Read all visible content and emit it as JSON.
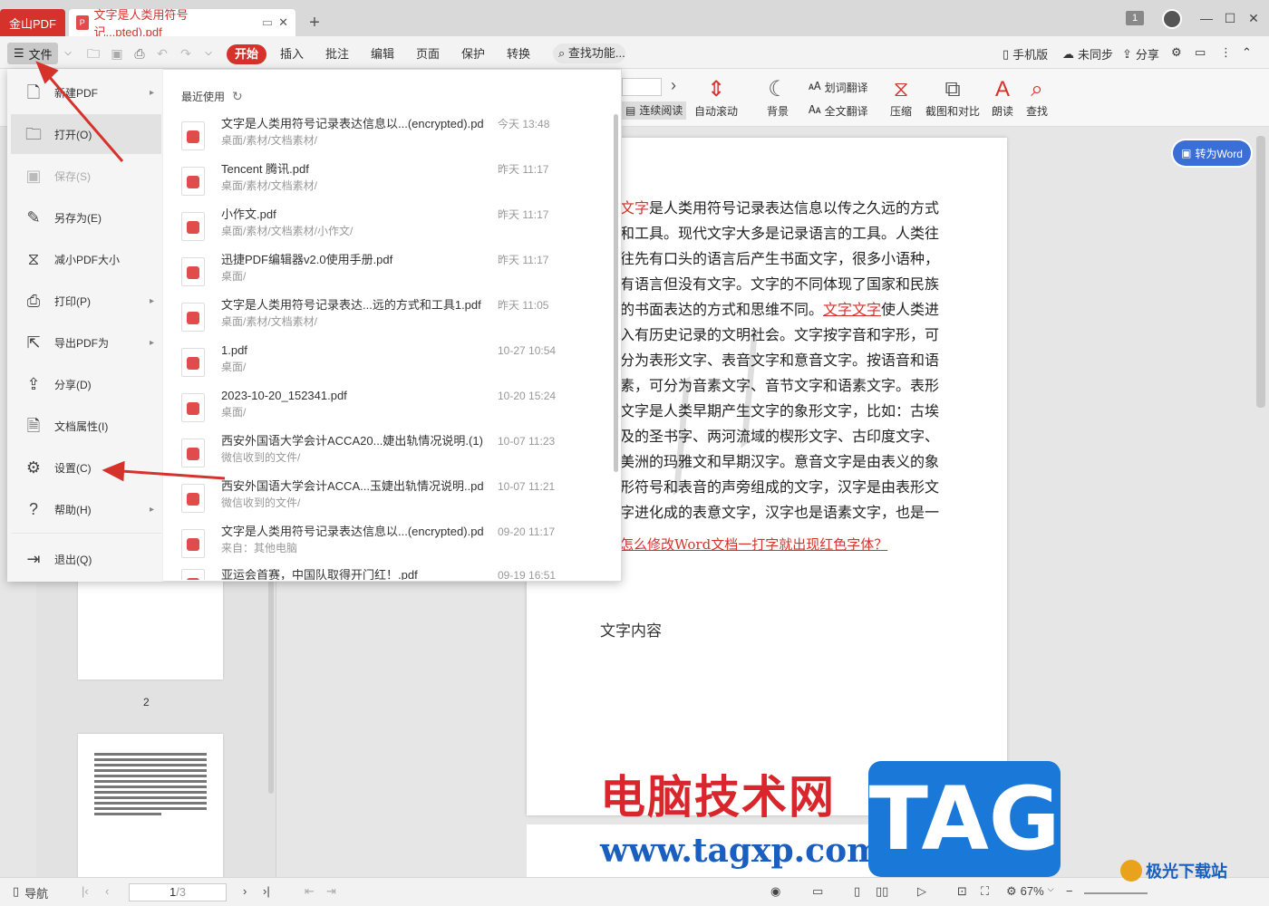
{
  "titlebar": {
    "app_name": "金山PDF",
    "doc_tab_title": "文字是人类用符号记...pted).pdf",
    "page_badge": "1"
  },
  "menubar": {
    "file_label": "文件",
    "tabs": [
      "开始",
      "插入",
      "批注",
      "编辑",
      "页面",
      "保护",
      "转换"
    ],
    "search_label": "查找功能...",
    "mobile_label": "手机版",
    "sync_label": "未同步",
    "share_label": "分享"
  },
  "ribbon": {
    "continuous_read": "连续阅读",
    "auto_scroll": "自动滚动",
    "background": "背景",
    "word_translate": "划词翻译",
    "full_translate": "全文翻译",
    "compress": "压缩",
    "screenshot_compare": "截图和对比",
    "read_aloud": "朗读",
    "find": "查找"
  },
  "file_menu": {
    "items": [
      {
        "label": "新建PDF",
        "icon": "new-pdf-icon",
        "has_sub": true
      },
      {
        "label": "打开(O)",
        "icon": "folder-icon",
        "has_sub": false
      },
      {
        "label": "保存(S)",
        "icon": "save-icon",
        "has_sub": false
      },
      {
        "label": "另存为(E)",
        "icon": "save-as-icon",
        "has_sub": false
      },
      {
        "label": "减小PDF大小",
        "icon": "compress-icon",
        "has_sub": false
      },
      {
        "label": "打印(P)",
        "icon": "print-icon",
        "has_sub": true
      },
      {
        "label": "导出PDF为",
        "icon": "export-icon",
        "has_sub": true
      },
      {
        "label": "分享(D)",
        "icon": "share-icon",
        "has_sub": false
      },
      {
        "label": "文档属性(I)",
        "icon": "properties-icon",
        "has_sub": false
      },
      {
        "label": "设置(C)",
        "icon": "gear-icon",
        "has_sub": false
      },
      {
        "label": "帮助(H)",
        "icon": "help-icon",
        "has_sub": true
      },
      {
        "label": "退出(Q)",
        "icon": "exit-icon",
        "has_sub": false
      }
    ],
    "recent_title": "最近使用",
    "recent_files": [
      {
        "name": "文字是人类用符号记录表达信息以...(encrypted).pdf",
        "path": "桌面/素材/文档素材/",
        "time": "今天 13:48"
      },
      {
        "name": "Tencent 腾讯.pdf",
        "path": "桌面/素材/文档素材/",
        "time": "昨天 11:17"
      },
      {
        "name": "小作文.pdf",
        "path": "桌面/素材/文档素材/小作文/",
        "time": "昨天 11:17"
      },
      {
        "name": "迅捷PDF编辑器v2.0使用手册.pdf",
        "path": "桌面/",
        "time": "昨天 11:17"
      },
      {
        "name": "文字是人类用符号记录表达...远的方式和工具1.pdf",
        "path": "桌面/素材/文档素材/",
        "time": "昨天 11:05"
      },
      {
        "name": "1.pdf",
        "path": "桌面/",
        "time": "10-27 10:54"
      },
      {
        "name": "2023-10-20_152341.pdf",
        "path": "桌面/",
        "time": "10-20 15:24"
      },
      {
        "name": "西安外国语大学会计ACCA20...婕出轨情况说明.(1).pdf",
        "path": "微信收到的文件/",
        "time": "10-07 11:23"
      },
      {
        "name": "西安外国语大学会计ACCA...玉婕出轨情况说明..pdf",
        "path": "微信收到的文件/",
        "time": "10-07 11:21"
      },
      {
        "name": "文字是人类用符号记录表达信息以...(encrypted).pdf",
        "path": "来自：其他电脑",
        "time": "09-20 11:17"
      },
      {
        "name": "亚运会首赛，中国队取得开门红！.pdf",
        "path": "",
        "time": "09-19 16:51"
      }
    ]
  },
  "document": {
    "red_word1": "文字",
    "para1": "是人类用符号记录表达信息以传之久远的方式和工具。现代文字大多是记录语言的工具。人类往往先有口头的语言后产生书面文字，很多小语种，有语言但没有文字。文字的不同体现了国家和民族的书面表达的方式和思维不同。",
    "red_word2": "文字文字",
    "para2": "使人类进入有历史记录的文明社会。文字按字音和字形，可分为表形文字、表音文字和意音文字。按语音和语素，可分为音素文字、音节文字和语素文字。表形文字是人类早期产生文字的象形文字，比如：古埃及的圣书字、两河流域的楔形文字、古印度文字、美洲的玛雅文和早期汉字。意音文字是由表义的象形符号和表音的声旁组成的文字，汉字是由表形文字进化成的表意文字，汉字也是语素文字，也是一种二维文字。",
    "link": "怎么修改Word文档一打字就出现红色字体？",
    "subtitle": "文字内容",
    "to_word_label": "转为Word"
  },
  "sidebar": {
    "page_label_2": "2"
  },
  "statusbar": {
    "nav_label": "导航",
    "page_current": "1",
    "page_total": "/3",
    "zoom": "67%"
  },
  "watermark": {
    "site_cn": "电脑技术网",
    "site_url": "www.tagxp.com",
    "tag": "TAG",
    "jg_label": "极光下载站"
  }
}
